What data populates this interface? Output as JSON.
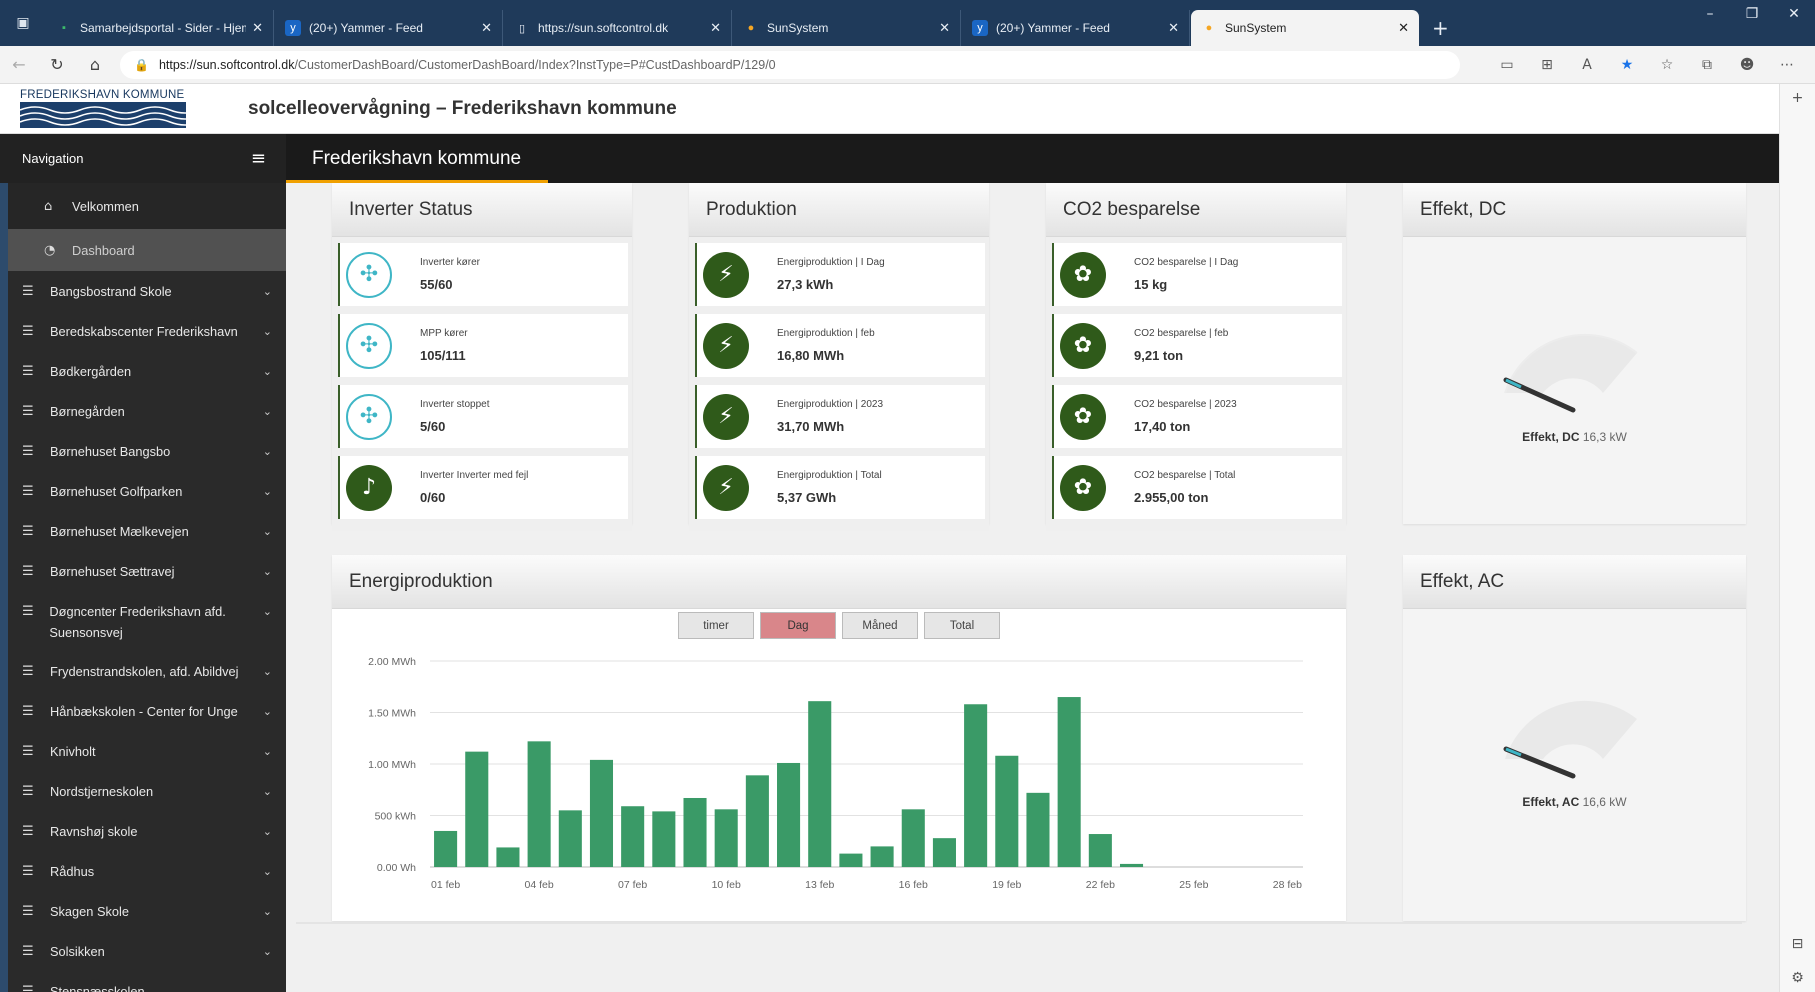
{
  "browser": {
    "tabs": [
      {
        "title": "Samarbejdsportal - Sider - Hjem",
        "icon": "sharepoint-icon"
      },
      {
        "title": "(20+) Yammer - Feed",
        "icon": "yammer-icon"
      },
      {
        "title": "https://sun.softcontrol.dk",
        "icon": "page-icon"
      },
      {
        "title": "SunSystem",
        "icon": "dot-icon"
      },
      {
        "title": "(20+) Yammer - Feed",
        "icon": "yammer-icon"
      },
      {
        "title": "SunSystem",
        "icon": "dot-icon"
      }
    ],
    "url_host": "https://sun.softcontrol.dk",
    "url_path": "/CustomerDashBoard/CustomerDashBoard/Index?InstType=P#CustDashboardP/129/0"
  },
  "header": {
    "logo_text": "FREDERIKSHAVN KOMMUNE",
    "site_title": "solcelleovervågning – Frederikshavn kommune"
  },
  "nav": {
    "heading": "Navigation",
    "page_heading": "Frederikshavn kommune",
    "top_items": [
      "Velkommen",
      "Dashboard"
    ],
    "items": [
      "Bangsbostrand Skole",
      "Beredskabscenter Frederikshavn",
      "Bødkergården",
      "Børnegården",
      "Børnehuset Bangsbo",
      "Børnehuset Golfparken",
      "Børnehuset Mælkevejen",
      "Børnehuset Sættravej",
      "Døgncenter Frederikshavn afd. Suensonsvej",
      "Frydenstrandskolen, afd. Abildvej",
      "Hånbækskolen - Center for Unge",
      "Knivholt",
      "Nordstjerneskolen",
      "Ravnshøj skole",
      "Rådhus",
      "Skagen Skole",
      "Solsikken",
      "Stensnæsskolen"
    ]
  },
  "inverter": {
    "title": "Inverter Status",
    "rows": [
      {
        "label": "Inverter kører",
        "value": "55/60"
      },
      {
        "label": "MPP kører",
        "value": "105/111"
      },
      {
        "label": "Inverter stoppet",
        "value": "5/60"
      },
      {
        "label": "Inverter Inverter med fejl",
        "value": "0/60"
      }
    ]
  },
  "produktion": {
    "title": "Produktion",
    "rows": [
      {
        "label": "Energiproduktion | I Dag",
        "value": "27,3 kWh"
      },
      {
        "label": "Energiproduktion | feb",
        "value": "16,80 MWh"
      },
      {
        "label": "Energiproduktion | 2023",
        "value": "31,70 MWh"
      },
      {
        "label": "Energiproduktion | Total",
        "value": "5,37 GWh"
      }
    ]
  },
  "co2": {
    "title": "CO2 besparelse",
    "rows": [
      {
        "label": "CO2 besparelse | I Dag",
        "value": "15 kg"
      },
      {
        "label": "CO2 besparelse | feb",
        "value": "9,21 ton"
      },
      {
        "label": "CO2 besparelse | 2023",
        "value": "17,40 ton"
      },
      {
        "label": "CO2 besparelse | Total",
        "value": "2.955,00 ton"
      }
    ]
  },
  "effekt_dc": {
    "title": "Effekt, DC",
    "label": "Effekt, DC",
    "value": "16,3 kW"
  },
  "effekt_ac": {
    "title": "Effekt, AC",
    "label": "Effekt, AC",
    "value": "16,6 kW"
  },
  "energi": {
    "title": "Energiproduktion",
    "buttons": [
      "timer",
      "Dag",
      "Måned",
      "Total"
    ],
    "active_button": "Dag"
  },
  "chart_data": {
    "type": "bar",
    "color": "#3a9a67",
    "categories": [
      "01 feb",
      "02 feb",
      "03 feb",
      "04 feb",
      "05 feb",
      "06 feb",
      "07 feb",
      "08 feb",
      "09 feb",
      "10 feb",
      "11 feb",
      "12 feb",
      "13 feb",
      "14 feb",
      "15 feb",
      "16 feb",
      "17 feb",
      "18 feb",
      "19 feb",
      "20 feb",
      "21 feb",
      "22 feb",
      "23 feb",
      "24 feb",
      "25 feb",
      "26 feb",
      "27 feb",
      "28 feb"
    ],
    "values_mwh": [
      0.35,
      1.12,
      0.19,
      1.22,
      0.55,
      1.04,
      0.59,
      0.54,
      0.67,
      0.56,
      0.89,
      1.01,
      1.61,
      0.13,
      0.2,
      0.56,
      0.28,
      1.58,
      1.08,
      0.72,
      1.65,
      0.32,
      0.03,
      0,
      0,
      0,
      0,
      0
    ],
    "y_ticks": [
      "0.00 Wh",
      "500 kWh",
      "1.00 MWh",
      "1.50 MWh",
      "2.00 MWh"
    ],
    "x_ticks": [
      "01 feb",
      "04 feb",
      "07 feb",
      "10 feb",
      "13 feb",
      "16 feb",
      "19 feb",
      "22 feb",
      "25 feb",
      "28 feb"
    ],
    "ylim": [
      0,
      2.0
    ]
  }
}
